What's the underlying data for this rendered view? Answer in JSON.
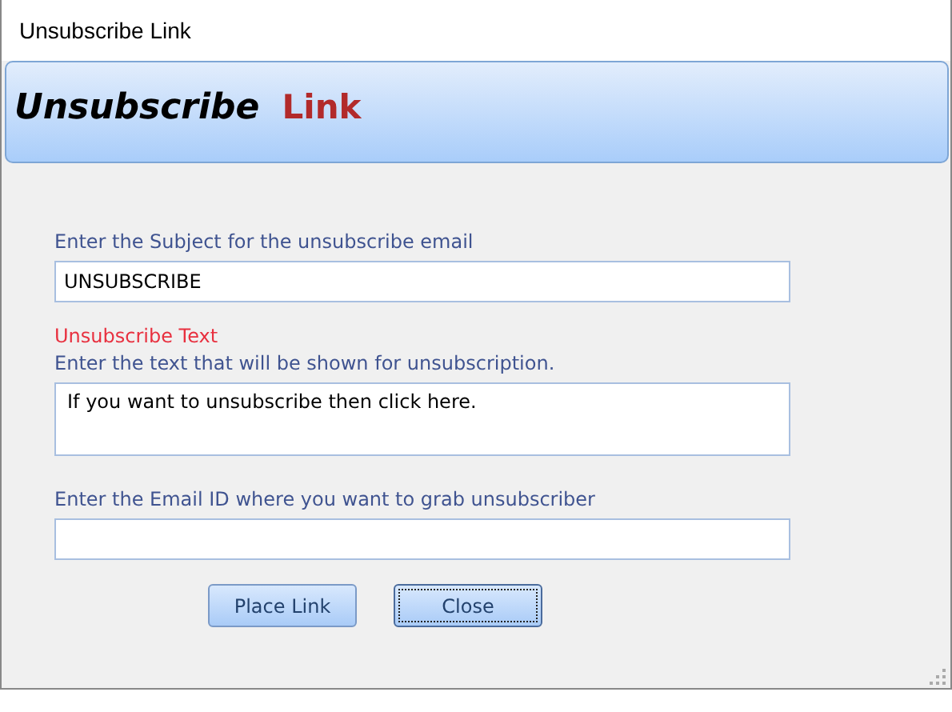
{
  "window": {
    "title": "Unsubscribe Link"
  },
  "banner": {
    "title": "Unsubscribe",
    "highlight": "Link"
  },
  "form": [
    {
      "kind": "label",
      "text": "Enter the Subject for the unsubscribe email"
    },
    {
      "kind": "input",
      "value": "UNSUBSCRIBE"
    },
    {
      "kind": "heading",
      "text": "Unsubscribe Text"
    },
    {
      "kind": "label",
      "text": "Enter the text that will be shown for unsubscription."
    },
    {
      "kind": "textarea",
      "value": "If you want to unsubscribe then click here."
    },
    {
      "kind": "label",
      "text": "Enter the Email ID where you want to grab unsubscriber"
    },
    {
      "kind": "input"
    }
  ],
  "buttons": [
    {
      "label": "Place Link",
      "focused": false
    },
    {
      "label": "Close",
      "focused": true
    }
  ]
}
